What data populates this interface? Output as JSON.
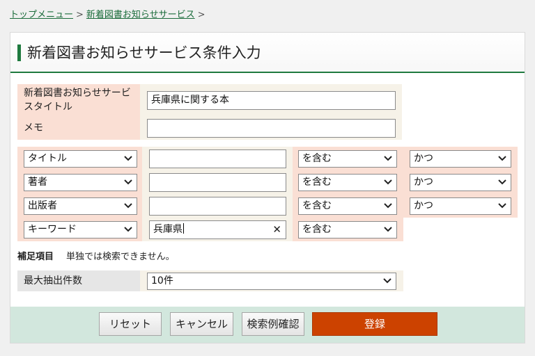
{
  "breadcrumb": {
    "top_menu": "トップメニュー",
    "separator1": ">",
    "current": "新着図書お知らせサービス",
    "separator2": ">"
  },
  "page": {
    "title": "新着図書お知らせサービス条件入力"
  },
  "fields": {
    "service_title_label_line1": "新着図書お知らせサービ",
    "service_title_label_line2": "スタイトル",
    "service_title_value": "兵庫県に関する本",
    "memo_label": "メモ",
    "memo_value": ""
  },
  "criteria": [
    {
      "field": "タイトル",
      "value": "",
      "match": "を含む",
      "conj": "かつ"
    },
    {
      "field": "著者",
      "value": "",
      "match": "を含む",
      "conj": "かつ"
    },
    {
      "field": "出版者",
      "value": "",
      "match": "を含む",
      "conj": "かつ"
    },
    {
      "field": "キーワード",
      "value": "兵庫県",
      "match": "を含む",
      "conj": ""
    }
  ],
  "supplement": {
    "label": "補足項目",
    "text": "単独では検索できません。"
  },
  "max_results": {
    "label": "最大抽出件数",
    "value": "10件"
  },
  "buttons": {
    "reset": "リセット",
    "cancel": "キャンセル",
    "preview": "検索例確認",
    "register": "登録"
  },
  "colors": {
    "accent_green": "#1f7a3f",
    "primary_button": "#cc4200",
    "footer_bg": "#d2e7dd",
    "label_pink": "#fadfd4"
  }
}
